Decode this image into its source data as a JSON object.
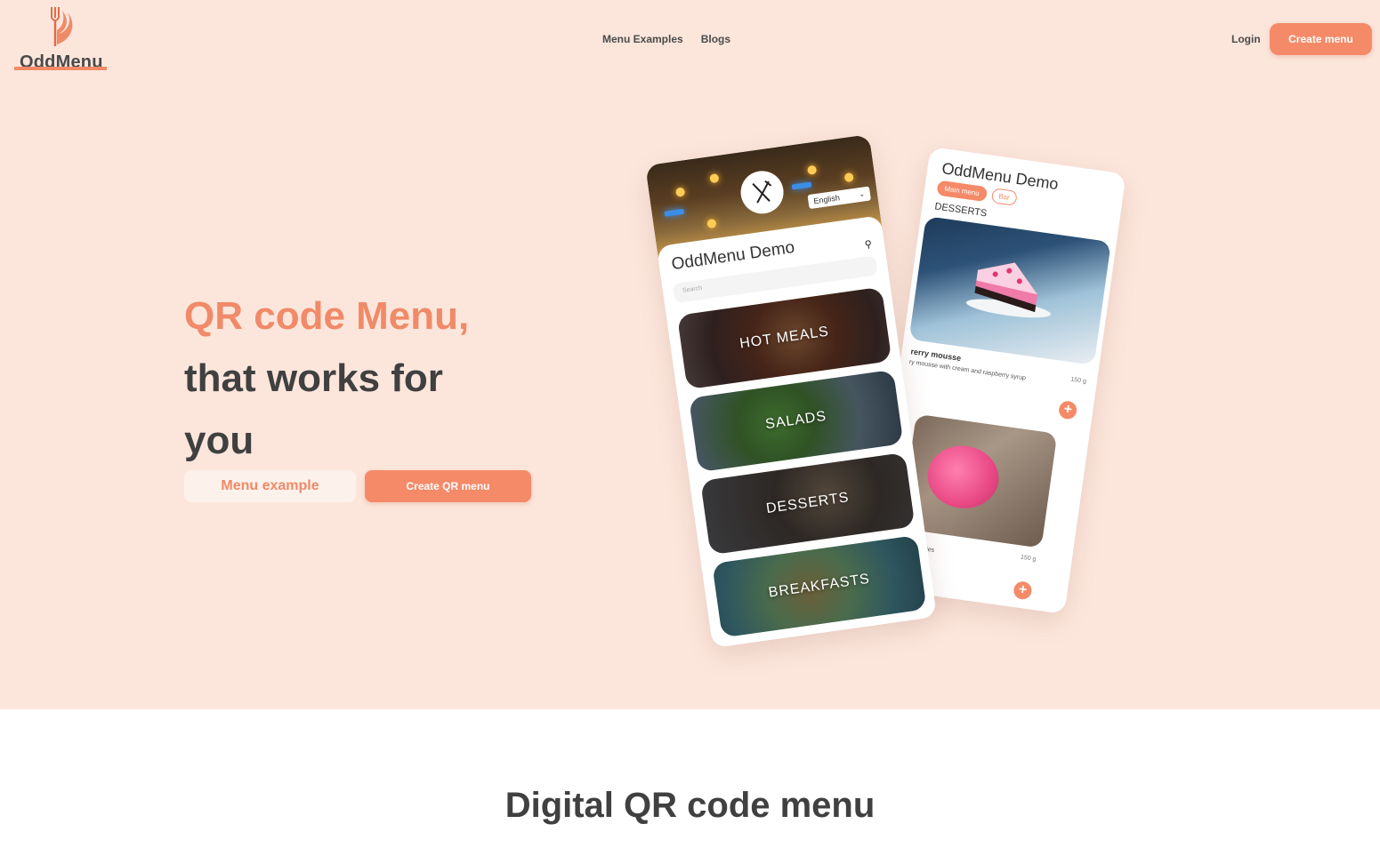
{
  "brand": {
    "name": "OddMenu",
    "accent": "#f58a68"
  },
  "nav": {
    "items": [
      "Menu Examples",
      "Blogs"
    ]
  },
  "header": {
    "login": "Login",
    "create_menu": "Create menu"
  },
  "hero": {
    "title_accent": "QR code Menu,",
    "title_line2": "that works for",
    "title_line3": "you",
    "btn_menu_example": "Menu example",
    "btn_create_qr": "Create QR menu"
  },
  "phone_front": {
    "language": "English",
    "title": "OddMenu Demo",
    "search_placeholder": "Search",
    "categories": [
      "HOT MEALS",
      "SALADS",
      "DESSERTS",
      "BREAKFASTS"
    ]
  },
  "phone_back": {
    "title": "OddMenu Demo",
    "tabs": [
      "Main menu",
      "Bar"
    ],
    "section": "DESSERTS",
    "item1_name": "rerry mousse",
    "item1_desc": "ry mousse with cream and raspberry syrup",
    "item1_weight": "150 g",
    "item2_desc": "from berries",
    "item2_weight": "150 g",
    "plus": "+"
  },
  "section2": {
    "title": "Digital QR code menu"
  }
}
